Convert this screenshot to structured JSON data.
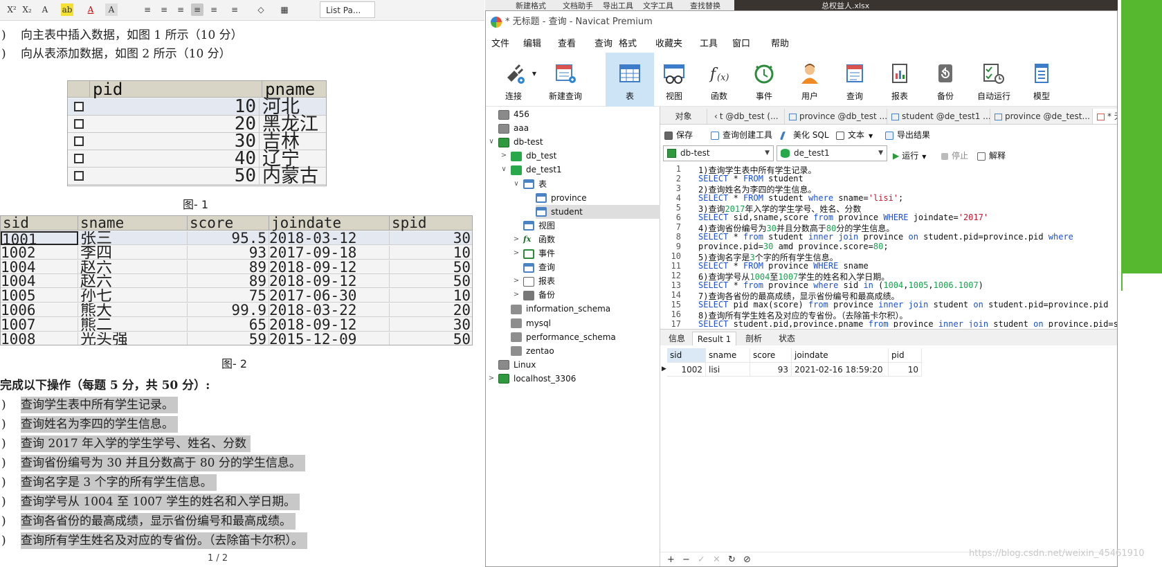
{
  "word": {
    "style_box": "List Pa...",
    "lines_top": [
      {
        "prefix": ")",
        "text": "向主表中插入数据，如图 1 所示（10 分）"
      },
      {
        "prefix": ")",
        "text": "向从表添加数据，如图 2 所示（10 分）"
      }
    ],
    "fig1": {
      "headers": [
        "pid",
        "pname"
      ],
      "rows": [
        {
          "pid": "10",
          "pname": "河北"
        },
        {
          "pid": "20",
          "pname": "黑龙江"
        },
        {
          "pid": "30",
          "pname": "吉林"
        },
        {
          "pid": "40",
          "pname": "辽宁"
        },
        {
          "pid": "50",
          "pname": "内蒙古"
        }
      ],
      "caption": "图- 1"
    },
    "fig2": {
      "headers": [
        "sid",
        "sname",
        "score",
        "joindate",
        "spid"
      ],
      "rows": [
        [
          "1001",
          "张三",
          "95.5",
          "2018-03-12",
          "30"
        ],
        [
          "1002",
          "李四",
          "93",
          "2017-09-18",
          "10"
        ],
        [
          "1004",
          "赵六",
          "89",
          "2018-09-12",
          "50"
        ],
        [
          "1004",
          "赵六",
          "89",
          "2018-09-12",
          "50"
        ],
        [
          "1005",
          "孙七",
          "75",
          "2017-06-30",
          "10"
        ],
        [
          "1006",
          "熊大",
          "99.9",
          "2018-03-22",
          "20"
        ],
        [
          "1007",
          "熊二",
          "65",
          "2018-09-12",
          "30"
        ],
        [
          "1008",
          "光头强",
          "59",
          "2015-12-09",
          "50"
        ]
      ],
      "caption": "图- 2"
    },
    "section_title": "完成以下操作（每题 5 分，共 50 分）:",
    "tasks": [
      {
        "prefix": ")",
        "text": "查询学生表中所有学生记录。"
      },
      {
        "prefix": ")",
        "text": "查询姓名为李四的学生信息。"
      },
      {
        "prefix": ")",
        "text": "查询 2017 年入学的学生学号、姓名、分数"
      },
      {
        "prefix": ")",
        "text": "查询省份编号为 30 并且分数高于 80 分的学生信息。"
      },
      {
        "prefix": ")",
        "text": "查询名字是 3 个字的所有学生信息。"
      },
      {
        "prefix": ")",
        "text": "查询学号从 1004 至 1007 学生的姓名和入学日期。"
      },
      {
        "prefix": ")",
        "text": "查询各省份的最高成绩，显示省份编号和最高成绩。"
      },
      {
        "prefix": ")",
        "text": "查询所有学生姓名及对应的专省份。（去除笛卡尔积）。"
      }
    ],
    "page_num": "1 / 2",
    "toolbar_glyphs": [
      "X²",
      "X₂",
      "A",
      "ab",
      "A",
      "A",
      "≡",
      "≡",
      "≡",
      "≡",
      "≡",
      "≡",
      "◇",
      "▦"
    ]
  },
  "strip": {
    "items": [
      "新建格式",
      "文档助手",
      "导出工具",
      "文字工具",
      "查找替换"
    ],
    "photo_text": "总权益人.xlsx"
  },
  "navicat": {
    "title": "* 无标题 - 查询 - Navicat Premium",
    "menu": [
      "文件",
      "编辑",
      "查看",
      "查询",
      "格式",
      "收藏夹",
      "工具",
      "窗口",
      "帮助"
    ],
    "toolbar": [
      {
        "label": "连接",
        "icon": "plug-icon"
      },
      {
        "label": "新建查询",
        "icon": "new-query-icon"
      },
      {
        "label": "表",
        "icon": "table-icon"
      },
      {
        "label": "视图",
        "icon": "view-icon"
      },
      {
        "label": "函数",
        "icon": "function-icon"
      },
      {
        "label": "事件",
        "icon": "event-clock-icon"
      },
      {
        "label": "用户",
        "icon": "user-icon"
      },
      {
        "label": "查询",
        "icon": "query-icon"
      },
      {
        "label": "报表",
        "icon": "report-icon"
      },
      {
        "label": "备份",
        "icon": "backup-icon"
      },
      {
        "label": "自动运行",
        "icon": "auto-run-icon"
      },
      {
        "label": "模型",
        "icon": "model-icon"
      }
    ],
    "tree": [
      {
        "label": "456",
        "icon": "connection-gray",
        "level": 0,
        "twisty": ""
      },
      {
        "label": "aaa",
        "icon": "connection-gray",
        "level": 0,
        "twisty": ""
      },
      {
        "label": "db-test",
        "icon": "connection",
        "level": 0,
        "twisty": "∨"
      },
      {
        "label": "db_test",
        "icon": "database",
        "level": 1,
        "twisty": ">"
      },
      {
        "label": "de_test1",
        "icon": "database",
        "level": 1,
        "twisty": "∨"
      },
      {
        "label": "表",
        "icon": "table",
        "level": 2,
        "twisty": "∨"
      },
      {
        "label": "province",
        "icon": "table",
        "level": 3,
        "twisty": ""
      },
      {
        "label": "student",
        "icon": "table",
        "level": 3,
        "twisty": "",
        "selected": true
      },
      {
        "label": "视图",
        "icon": "view",
        "level": 2,
        "twisty": ""
      },
      {
        "label": "函数",
        "icon": "function",
        "level": 2,
        "twisty": ">"
      },
      {
        "label": "事件",
        "icon": "event",
        "level": 2,
        "twisty": ">"
      },
      {
        "label": "查询",
        "icon": "query",
        "level": 2,
        "twisty": ""
      },
      {
        "label": "报表",
        "icon": "report",
        "level": 2,
        "twisty": ">"
      },
      {
        "label": "备份",
        "icon": "backup",
        "level": 2,
        "twisty": ">"
      },
      {
        "label": "information_schema",
        "icon": "database-gray",
        "level": 1,
        "twisty": ""
      },
      {
        "label": "mysql",
        "icon": "database-gray",
        "level": 1,
        "twisty": ""
      },
      {
        "label": "performance_schema",
        "icon": "database-gray",
        "level": 1,
        "twisty": ""
      },
      {
        "label": "zentao",
        "icon": "database-gray",
        "level": 1,
        "twisty": ""
      },
      {
        "label": "Linux",
        "icon": "connection-gray",
        "level": 0,
        "twisty": ""
      },
      {
        "label": "localhost_3306",
        "icon": "connection",
        "level": 0,
        "twisty": ">"
      }
    ],
    "tabs": [
      "对象",
      "t @db_test (...",
      "province @db_test ...",
      "student @de_test1 ...",
      "province @de_test...",
      "* 无"
    ],
    "query_tools": [
      "保存",
      "查询创建工具",
      "美化 SQL",
      "文本",
      "导出结果"
    ],
    "connection_select": "db-test",
    "database_select": "de_test1",
    "run_tools": [
      "运行",
      "停止",
      "解释"
    ],
    "sql_lines": [
      [
        {
          "t": "1)查询学生表中所有学生记录。",
          "c": ""
        }
      ],
      [
        {
          "t": "SELECT",
          "c": "k"
        },
        {
          "t": " * ",
          "c": ""
        },
        {
          "t": "FROM",
          "c": "k"
        },
        {
          "t": " student",
          "c": ""
        }
      ],
      [
        {
          "t": "2)查询姓名为李四的学生信息。",
          "c": ""
        }
      ],
      [
        {
          "t": "SELECT",
          "c": "k"
        },
        {
          "t": " * ",
          "c": ""
        },
        {
          "t": "FROM",
          "c": "k"
        },
        {
          "t": " student ",
          "c": ""
        },
        {
          "t": "where",
          "c": "k"
        },
        {
          "t": " sname=",
          "c": ""
        },
        {
          "t": "'lisi'",
          "c": "s"
        },
        {
          "t": ";",
          "c": ""
        }
      ],
      [
        {
          "t": "3)查询",
          "c": ""
        },
        {
          "t": "2017",
          "c": "n"
        },
        {
          "t": "年入学的学生学号、姓名、分数",
          "c": ""
        }
      ],
      [
        {
          "t": "SELECT",
          "c": "k"
        },
        {
          "t": " sid,sname,score ",
          "c": ""
        },
        {
          "t": "from",
          "c": "k"
        },
        {
          "t": " province ",
          "c": ""
        },
        {
          "t": "WHERE",
          "c": "k"
        },
        {
          "t": " joindate=",
          "c": ""
        },
        {
          "t": "'2017'",
          "c": "s"
        }
      ],
      [
        {
          "t": "4)查询省份编号为",
          "c": ""
        },
        {
          "t": "30",
          "c": "n"
        },
        {
          "t": "并且分数高于",
          "c": ""
        },
        {
          "t": "80",
          "c": "n"
        },
        {
          "t": "分的学生信息。",
          "c": ""
        }
      ],
      [
        {
          "t": "SELECT",
          "c": "k"
        },
        {
          "t": " * ",
          "c": ""
        },
        {
          "t": "from",
          "c": "k"
        },
        {
          "t": " student ",
          "c": ""
        },
        {
          "t": "inner join",
          "c": "k"
        },
        {
          "t": " province ",
          "c": ""
        },
        {
          "t": "on",
          "c": "k"
        },
        {
          "t": " student.pid=province.pid ",
          "c": ""
        },
        {
          "t": "where",
          "c": "k"
        }
      ],
      [
        {
          "t": "province.pid=",
          "c": ""
        },
        {
          "t": "30",
          "c": "n"
        },
        {
          "t": " amd province.score=",
          "c": ""
        },
        {
          "t": "80",
          "c": "n"
        },
        {
          "t": ";",
          "c": ""
        }
      ],
      [
        {
          "t": "5)查询名字是",
          "c": ""
        },
        {
          "t": "3",
          "c": "n"
        },
        {
          "t": "个字的所有学生信息。",
          "c": ""
        }
      ],
      [
        {
          "t": "SELECT",
          "c": "k"
        },
        {
          "t": " * ",
          "c": ""
        },
        {
          "t": "FROM",
          "c": "k"
        },
        {
          "t": " province ",
          "c": ""
        },
        {
          "t": "WHERE",
          "c": "k"
        },
        {
          "t": " sname",
          "c": ""
        }
      ],
      [
        {
          "t": "6)查询学号从",
          "c": ""
        },
        {
          "t": "1004",
          "c": "n"
        },
        {
          "t": "至",
          "c": ""
        },
        {
          "t": "1007",
          "c": "n"
        },
        {
          "t": "学生的姓名和入学日期。",
          "c": ""
        }
      ],
      [
        {
          "t": "SELECT",
          "c": "k"
        },
        {
          "t": " * ",
          "c": ""
        },
        {
          "t": "from",
          "c": "k"
        },
        {
          "t": " province ",
          "c": ""
        },
        {
          "t": "where",
          "c": "k"
        },
        {
          "t": " sid ",
          "c": ""
        },
        {
          "t": "in",
          "c": "k"
        },
        {
          "t": " (",
          "c": ""
        },
        {
          "t": "1004",
          "c": "n"
        },
        {
          "t": ",",
          "c": ""
        },
        {
          "t": "1005",
          "c": "n"
        },
        {
          "t": ",",
          "c": ""
        },
        {
          "t": "1006.1007",
          "c": "n"
        },
        {
          "t": ")",
          "c": ""
        }
      ],
      [
        {
          "t": "7)查询各省份的最高成绩，显示省份编号和最高成绩。",
          "c": ""
        }
      ],
      [
        {
          "t": "SELECT",
          "c": "k"
        },
        {
          "t": " pid max(score) ",
          "c": ""
        },
        {
          "t": "from",
          "c": "k"
        },
        {
          "t": " province ",
          "c": ""
        },
        {
          "t": "inner join",
          "c": "k"
        },
        {
          "t": " student ",
          "c": ""
        },
        {
          "t": "on",
          "c": "k"
        },
        {
          "t": " student.pid=province.pid",
          "c": ""
        }
      ],
      [
        {
          "t": "8)查询所有学生姓名及对应的专省份。（去除笛卡尔积）。",
          "c": ""
        }
      ],
      [
        {
          "t": "SELECT",
          "c": "k"
        },
        {
          "t": " student.pid,province.pname ",
          "c": ""
        },
        {
          "t": "from",
          "c": "k"
        },
        {
          "t": " province ",
          "c": ""
        },
        {
          "t": "inner join",
          "c": "k"
        },
        {
          "t": " student ",
          "c": ""
        },
        {
          "t": "on",
          "c": "k"
        },
        {
          "t": " province.pid=student.pid",
          "c": ""
        }
      ]
    ],
    "result_tabs": [
      "信息",
      "Result 1",
      "剖析",
      "状态"
    ],
    "result_columns": [
      "sid",
      "sname",
      "score",
      "joindate",
      "pid"
    ],
    "result_rows": [
      [
        "1002",
        "lisi",
        "93",
        "2021-02-16 18:59:20",
        "10"
      ]
    ],
    "footer_buttons": [
      "+",
      "−",
      "✓",
      "✕",
      "↻",
      "⊘"
    ]
  },
  "watermark": "https://blog.csdn.net/weixin_45461910"
}
